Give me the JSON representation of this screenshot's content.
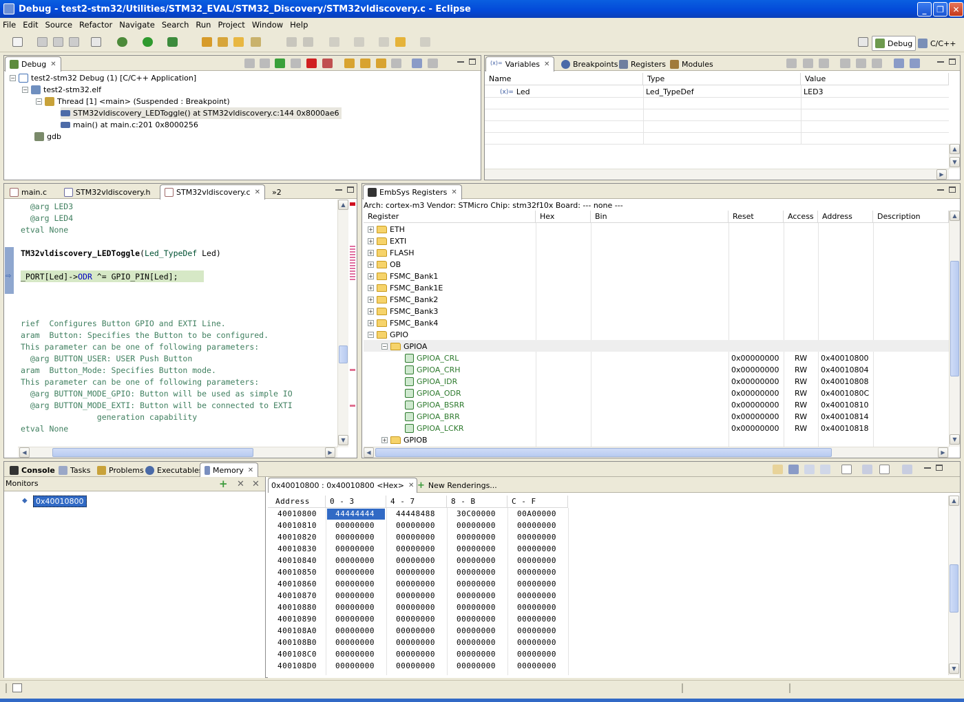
{
  "window": {
    "title": "Debug - test2-stm32/Utilities/STM32_EVAL/STM32_Discovery/STM32vldiscovery.c - Eclipse"
  },
  "menu": [
    "File",
    "Edit",
    "Source",
    "Refactor",
    "Navigate",
    "Search",
    "Run",
    "Project",
    "Window",
    "Help"
  ],
  "perspectives": {
    "debug": "Debug",
    "cpp": "C/C++"
  },
  "debug_view": {
    "tab": "Debug",
    "items": [
      "test2-stm32 Debug (1) [C/C++ Application]",
      "test2-stm32.elf",
      "Thread [1] <main> (Suspended : Breakpoint)",
      "STM32vldiscovery_LEDToggle() at STM32vldiscovery.c:144 0x8000ae6",
      "main() at main.c:201 0x8000256",
      "gdb"
    ]
  },
  "variables_view": {
    "tabs": [
      "Variables",
      "Breakpoints",
      "Registers",
      "Modules"
    ],
    "columns": [
      "Name",
      "Type",
      "Value"
    ],
    "rows": [
      {
        "name": "Led",
        "type": "Led_TypeDef",
        "value": "LED3"
      }
    ]
  },
  "editor": {
    "tabs": [
      "main.c",
      "STM32vldiscovery.h",
      "STM32vldiscovery.c",
      "»2"
    ],
    "lines": [
      "  @arg LED3",
      "  @arg LED4",
      "etval None",
      "",
      "TM32vldiscovery_LEDToggle(Led_TypeDef Led)",
      "",
      "_PORT[Led]->ODR ^= GPIO_PIN[Led];",
      "",
      "",
      "",
      "rief  Configures Button GPIO and EXTI Line.",
      "aram  Button: Specifies the Button to be configured.",
      "This parameter can be one of following parameters:",
      "  @arg BUTTON_USER: USER Push Button",
      "aram  Button_Mode: Specifies Button mode.",
      "This parameter can be one of following parameters:",
      "  @arg BUTTON_MODE_GPIO: Button will be used as simple IO",
      "  @arg BUTTON_MODE_EXTI: Button will be connected to EXTI",
      "                generation capability",
      "etval None"
    ]
  },
  "embsys": {
    "tab": "EmbSys Registers",
    "info": "Arch: cortex-m3  Vendor: STMicro  Chip: stm32f10x  Board: ---  none ---",
    "columns": [
      "Register",
      "Hex",
      "Bin",
      "Reset",
      "Access",
      "Address",
      "Description"
    ],
    "folders": [
      "ETH",
      "EXTI",
      "FLASH",
      "OB",
      "FSMC_Bank1",
      "FSMC_Bank1E",
      "FSMC_Bank2",
      "FSMC_Bank3",
      "FSMC_Bank4",
      "GPIO"
    ],
    "gpioa": "GPIOA",
    "registers": [
      {
        "name": "GPIOA_CRL",
        "reset": "0x00000000",
        "access": "RW",
        "address": "0x40010800"
      },
      {
        "name": "GPIOA_CRH",
        "reset": "0x00000000",
        "access": "RW",
        "address": "0x40010804"
      },
      {
        "name": "GPIOA_IDR",
        "reset": "0x00000000",
        "access": "RW",
        "address": "0x40010808"
      },
      {
        "name": "GPIOA_ODR",
        "reset": "0x00000000",
        "access": "RW",
        "address": "0x4001080C"
      },
      {
        "name": "GPIOA_BSRR",
        "reset": "0x00000000",
        "access": "RW",
        "address": "0x40010810"
      },
      {
        "name": "GPIOA_BRR",
        "reset": "0x00000000",
        "access": "RW",
        "address": "0x40010814"
      },
      {
        "name": "GPIOA_LCKR",
        "reset": "0x00000000",
        "access": "RW",
        "address": "0x40010818"
      }
    ],
    "gpiob": "GPIOB"
  },
  "bottom": {
    "tabs": [
      "Console",
      "Tasks",
      "Problems",
      "Executables",
      "Memory"
    ],
    "monitors_label": "Monitors",
    "monitor_item": "0x40010800",
    "rendering_tab": "0x40010800 : 0x40010800 <Hex>",
    "new_renderings": "New Renderings...",
    "columns": [
      "Address",
      "0 - 3",
      "4 - 7",
      "8 - B",
      "C - F"
    ],
    "rows": [
      [
        "40010800",
        "44444444",
        "44448488",
        "30C00000",
        "00A00000"
      ],
      [
        "40010810",
        "00000000",
        "00000000",
        "00000000",
        "00000000"
      ],
      [
        "40010820",
        "00000000",
        "00000000",
        "00000000",
        "00000000"
      ],
      [
        "40010830",
        "00000000",
        "00000000",
        "00000000",
        "00000000"
      ],
      [
        "40010840",
        "00000000",
        "00000000",
        "00000000",
        "00000000"
      ],
      [
        "40010850",
        "00000000",
        "00000000",
        "00000000",
        "00000000"
      ],
      [
        "40010860",
        "00000000",
        "00000000",
        "00000000",
        "00000000"
      ],
      [
        "40010870",
        "00000000",
        "00000000",
        "00000000",
        "00000000"
      ],
      [
        "40010880",
        "00000000",
        "00000000",
        "00000000",
        "00000000"
      ],
      [
        "40010890",
        "00000000",
        "00000000",
        "00000000",
        "00000000"
      ],
      [
        "400108A0",
        "00000000",
        "00000000",
        "00000000",
        "00000000"
      ],
      [
        "400108B0",
        "00000000",
        "00000000",
        "00000000",
        "00000000"
      ],
      [
        "400108C0",
        "00000000",
        "00000000",
        "00000000",
        "00000000"
      ],
      [
        "400108D0",
        "00000000",
        "00000000",
        "00000000",
        "00000000"
      ]
    ]
  },
  "colors": {
    "title_blue": "#0349d8",
    "selection": "#316ac5",
    "current_line": "#d6e8c6",
    "comment": "#3f7f5f"
  }
}
